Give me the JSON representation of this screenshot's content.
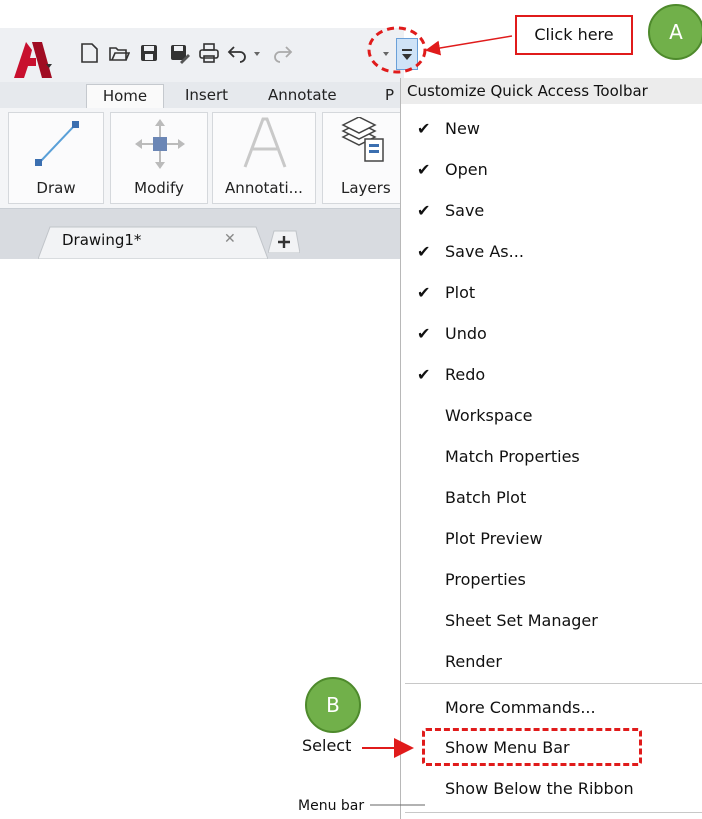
{
  "ribbon": {
    "tabs": [
      "Home",
      "Insert",
      "Annotate",
      "P"
    ],
    "panels": [
      "Draw",
      "Modify",
      "Annotati...",
      "Layers"
    ]
  },
  "document_tab": {
    "title": "Drawing1*"
  },
  "menu": {
    "title": "Customize Quick Access Toolbar",
    "checked_items": [
      "New",
      "Open",
      "Save",
      "Save As...",
      "Plot",
      "Undo",
      "Redo"
    ],
    "items": [
      "Workspace",
      "Match Properties",
      "Batch Plot",
      "Plot Preview",
      "Properties",
      "Sheet Set Manager",
      "Render"
    ],
    "more_commands": "More Commands...",
    "show_menu_bar": "Show Menu Bar",
    "show_below_ribbon": "Show Below the Ribbon"
  },
  "annotations": {
    "callout": "Click here",
    "badge_a": "A",
    "badge_b": "B",
    "select": "Select",
    "menu_bar": "Menu bar"
  },
  "colors": {
    "annotation_red": "#e01b1b",
    "badge_green": "#71b04a",
    "logo_red": "#c8102e"
  }
}
